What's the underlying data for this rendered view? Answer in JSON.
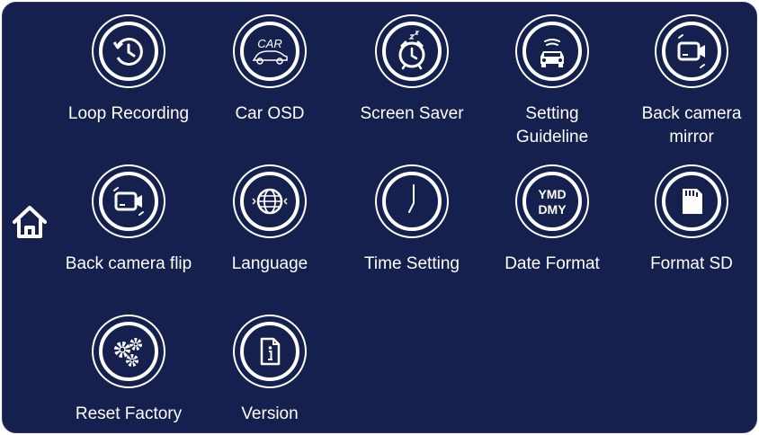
{
  "home": {
    "icon": "home-icon"
  },
  "menu": {
    "items": [
      {
        "label": "Loop Recording",
        "icon": "loop-recording-icon"
      },
      {
        "label": "Car OSD",
        "icon": "car-osd-icon",
        "icon_text": "CAR"
      },
      {
        "label": "Screen Saver",
        "icon": "alarm-clock-icon"
      },
      {
        "label": "Setting\nGuideline",
        "icon": "car-guideline-icon"
      },
      {
        "label": "Back camera\nmirror",
        "icon": "camera-mirror-icon"
      },
      {
        "label": "Back camera flip",
        "icon": "camera-flip-icon"
      },
      {
        "label": "Language",
        "icon": "globe-icon"
      },
      {
        "label": "Time Setting",
        "icon": "clock-icon"
      },
      {
        "label": "Date Format",
        "icon": "date-format-icon",
        "icon_text_top": "YMD",
        "icon_text_bottom": "DMY"
      },
      {
        "label": "Format SD",
        "icon": "sd-card-icon"
      },
      {
        "label": "Reset Factory",
        "icon": "gears-icon"
      },
      {
        "label": "Version",
        "icon": "info-document-icon"
      }
    ]
  },
  "colors": {
    "background": "#15204e",
    "foreground": "#ffffff"
  }
}
